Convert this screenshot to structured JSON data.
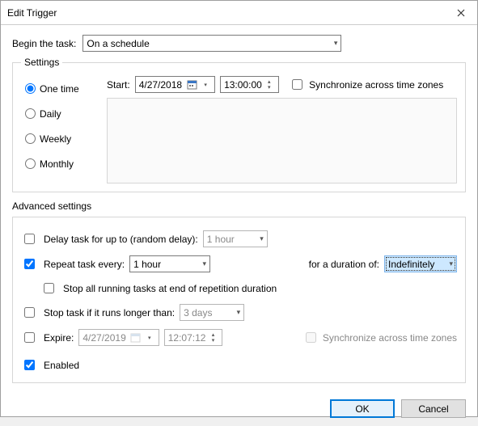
{
  "window": {
    "title": "Edit Trigger"
  },
  "begin": {
    "label": "Begin the task:",
    "value": "On a schedule"
  },
  "settings": {
    "legend": "Settings",
    "frequency": {
      "one_time": "One time",
      "daily": "Daily",
      "weekly": "Weekly",
      "monthly": "Monthly",
      "selected": "one_time"
    },
    "start_label": "Start:",
    "start_date": "4/27/2018",
    "start_time": "13:00:00",
    "sync_tz": "Synchronize across time zones"
  },
  "advanced": {
    "heading": "Advanced settings",
    "delay": {
      "label": "Delay task for up to (random delay):",
      "value": "1 hour",
      "checked": false
    },
    "repeat": {
      "label": "Repeat task every:",
      "value": "1 hour",
      "checked": true,
      "duration_label": "for a duration of:",
      "duration_value": "Indefinitely"
    },
    "stop_repetition": {
      "label": "Stop all running tasks at end of repetition duration",
      "checked": false
    },
    "stop_if_longer": {
      "label": "Stop task if it runs longer than:",
      "value": "3 days",
      "checked": false
    },
    "expire": {
      "label": "Expire:",
      "date": "4/27/2019",
      "time": "12:07:12",
      "checked": false,
      "sync_tz": "Synchronize across time zones"
    },
    "enabled": {
      "label": "Enabled",
      "checked": true
    }
  },
  "buttons": {
    "ok": "OK",
    "cancel": "Cancel"
  }
}
